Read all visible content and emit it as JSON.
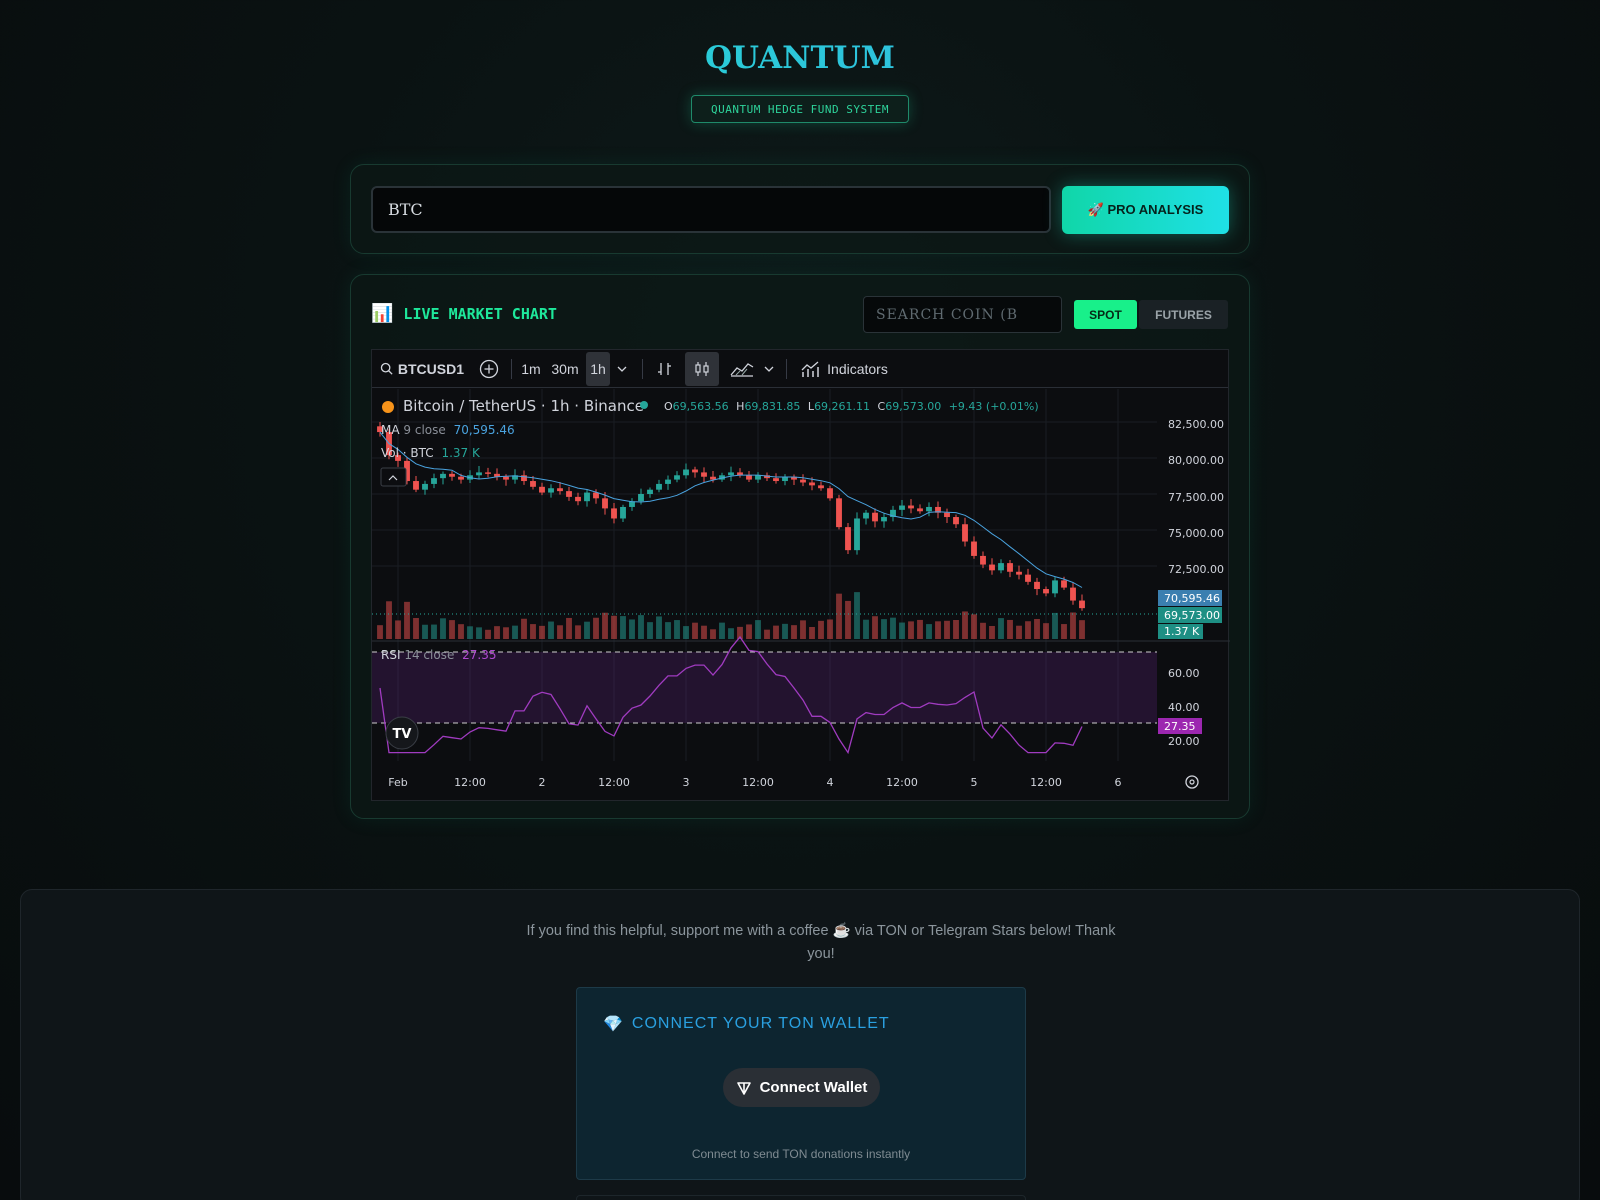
{
  "brand": {
    "title": "QUANTUM",
    "subtitle": "QUANTUM HEDGE FUND SYSTEM"
  },
  "search": {
    "value": "BTC",
    "button_label": "🚀 PRO ANALYSIS"
  },
  "chart_panel": {
    "title": "LIVE MARKET CHART",
    "title_icon": "bar-chart-icon",
    "coin_search_placeholder": "SEARCH COIN (B",
    "modes": [
      "SPOT",
      "FUTURES"
    ],
    "active_mode": "SPOT"
  },
  "tv": {
    "symbol": "BTCUSD1",
    "intervals": [
      "1m",
      "30m",
      "1h"
    ],
    "active_interval": "1h",
    "indicators_label": "Indicators",
    "legend": {
      "pair": "Bitcoin / TetherUS · 1h · Binance",
      "o_label": "O",
      "o": "69,563.56",
      "h_label": "H",
      "h": "69,831.85",
      "l_label": "L",
      "l": "69,261.11",
      "c_label": "C",
      "c": "69,573.00",
      "change": "+9.43 (+0.01%)",
      "ma_label": "MA",
      "ma_params": "9 close",
      "ma_value": "70,595.46",
      "vol_label": "Vol · BTC",
      "vol_value": "1.37 K",
      "rsi_label": "RSI",
      "rsi_params": "14 close",
      "rsi_value": "27.35"
    },
    "price_axis": [
      "82,500.00",
      "80,000.00",
      "77,500.00",
      "75,000.00",
      "72,500.00"
    ],
    "price_badges": {
      "ma": "70,595.46",
      "close": "69,573.00",
      "volume": "1.37 K"
    },
    "rsi_axis": [
      "60.00",
      "40.00",
      "20.00"
    ],
    "rsi_badge": "27.35",
    "time_axis": [
      "Feb",
      "12:00",
      "2",
      "12:00",
      "3",
      "12:00",
      "4",
      "12:00",
      "5",
      "12:00",
      "6"
    ],
    "colors": {
      "up": "#26a69a",
      "down": "#ef5350",
      "ma": "#4aa3df",
      "rsi": "#9c27b0"
    }
  },
  "chart_data": {
    "type": "candlestick",
    "title": "Bitcoin / TetherUS · 1h · Binance",
    "ylim": [
      68000,
      84000
    ],
    "close_series": [
      81800,
      80200,
      79800,
      78400,
      77800,
      78200,
      78600,
      78900,
      78700,
      78500,
      78800,
      79000,
      78900,
      78700,
      78500,
      78800,
      78400,
      78000,
      77600,
      77900,
      77700,
      77300,
      77000,
      77600,
      77200,
      76500,
      75800,
      76600,
      77000,
      77500,
      77800,
      78200,
      78500,
      78800,
      79200,
      79000,
      78700,
      78500,
      78800,
      79000,
      78800,
      78500,
      78800,
      78600,
      78400,
      78700,
      78500,
      78300,
      78100,
      77900,
      77200,
      75200,
      73600,
      75800,
      76200,
      75600,
      75900,
      76400,
      76700,
      76500,
      76300,
      76600,
      76200,
      75900,
      75400,
      74200,
      73200,
      72600,
      72200,
      72700,
      72100,
      71900,
      71400,
      70900,
      70600,
      71500,
      71000,
      70100,
      69573
    ],
    "rsi": {
      "upper": 70,
      "lower": 30,
      "current": 27.35
    },
    "time_labels": [
      "Feb",
      "12:00",
      "2",
      "12:00",
      "3",
      "12:00",
      "4",
      "12:00",
      "5",
      "12:00",
      "6"
    ]
  },
  "support": {
    "text": "If you find this helpful, support me with a coffee ☕ via TON or Telegram Stars below! Thank you!",
    "ton_title": "CONNECT YOUR TON WALLET",
    "connect_label": "Connect Wallet",
    "note": "Connect to send TON donations instantly"
  }
}
